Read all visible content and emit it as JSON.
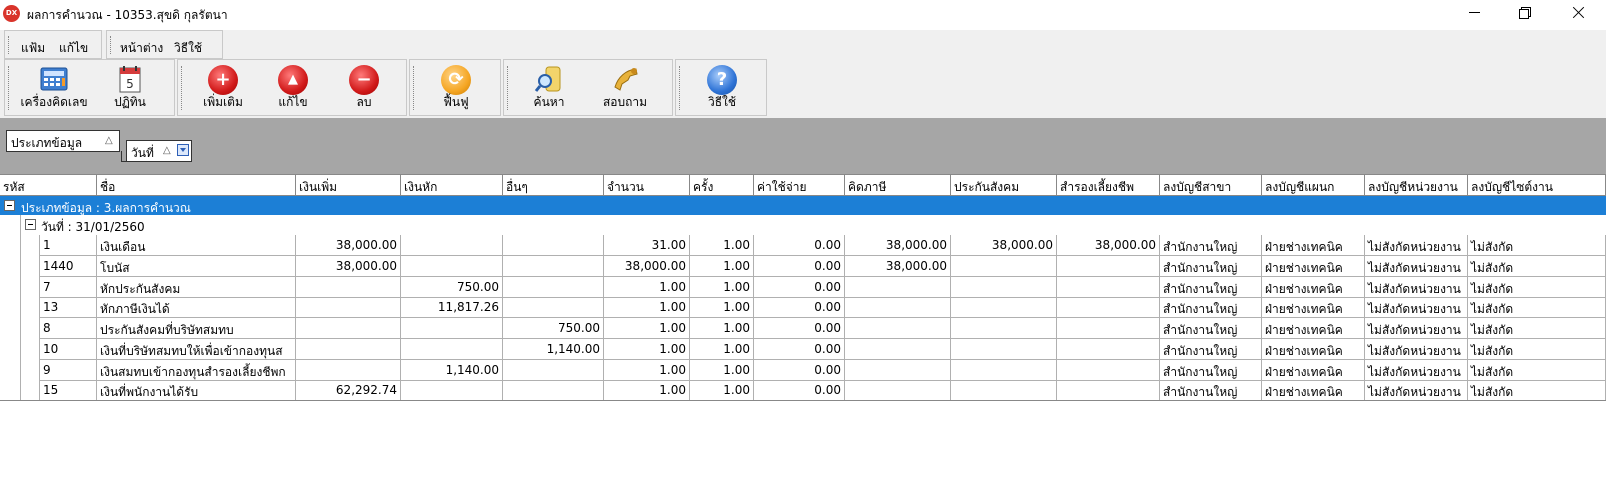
{
  "window": {
    "app_icon": "DX",
    "title": "ผลการคำนวณ - 10353.สุขดิ กุลรัตนา"
  },
  "menu": {
    "group1": [
      "แฟ้ม",
      "แก้ไข"
    ],
    "group2": [
      "หน้าต่าง",
      "วิธีใช้"
    ]
  },
  "toolbar": {
    "calculator": "เครื่องคิดเลข",
    "calendar": "ปฏิทิน",
    "calendar_day": "5",
    "add": "เพิ่มเติม",
    "edit": "แก้ไข",
    "delete": "ลบ",
    "restore": "ฟื้นฟู",
    "search": "ค้นหา",
    "inquiry": "สอบถาม",
    "help": "วิธีใช้"
  },
  "group_panel": {
    "field1": "ประเภทข้อมูล",
    "field2": "วันที่"
  },
  "columns": [
    "รหัส",
    "ชื่อ",
    "เงินเพิ่ม",
    "เงินหัก",
    "อื่นๆ",
    "จำนวน",
    "ครั้ง",
    "ค่าใช้จ่าย",
    "คิดภาษี",
    "ประกันสังคม",
    "สำรองเลี้ยงชีพ",
    "ลงบัญชีสาขา",
    "ลงบัญชีแผนก",
    "ลงบัญชีหน่วยงาน",
    "ลงบัญชีไซต์งาน"
  ],
  "group_rows": {
    "level1": "ประเภทข้อมูล : 3.ผลการคำนวณ",
    "level2": "วันที่ : 31/01/2560"
  },
  "rows": [
    [
      "1",
      "เงินเดือน",
      "38,000.00",
      "",
      "",
      "31.00",
      "1.00",
      "0.00",
      "38,000.00",
      "38,000.00",
      "38,000.00",
      "สำนักงานใหญ่",
      "ฝ่ายช่างเทคนิค",
      "ไม่สังกัดหน่วยงาน",
      "ไม่สังกัด"
    ],
    [
      "1440",
      "โบนัส",
      "38,000.00",
      "",
      "",
      "38,000.00",
      "1.00",
      "0.00",
      "38,000.00",
      "",
      "",
      "สำนักงานใหญ่",
      "ฝ่ายช่างเทคนิค",
      "ไม่สังกัดหน่วยงาน",
      "ไม่สังกัด"
    ],
    [
      "7",
      "หักประกันสังคม",
      "",
      "750.00",
      "",
      "1.00",
      "1.00",
      "0.00",
      "",
      "",
      "",
      "สำนักงานใหญ่",
      "ฝ่ายช่างเทคนิค",
      "ไม่สังกัดหน่วยงาน",
      "ไม่สังกัด"
    ],
    [
      "13",
      "หักภาษีเงินได้",
      "",
      "11,817.26",
      "",
      "1.00",
      "1.00",
      "0.00",
      "",
      "",
      "",
      "สำนักงานใหญ่",
      "ฝ่ายช่างเทคนิค",
      "ไม่สังกัดหน่วยงาน",
      "ไม่สังกัด"
    ],
    [
      "8",
      "ประกันสังคมที่บริษัทสมทบ",
      "",
      "",
      "750.00",
      "1.00",
      "1.00",
      "0.00",
      "",
      "",
      "",
      "สำนักงานใหญ่",
      "ฝ่ายช่างเทคนิค",
      "ไม่สังกัดหน่วยงาน",
      "ไม่สังกัด"
    ],
    [
      "10",
      "เงินที่บริษัทสมทบให้เพื่อเข้ากองทุนส",
      "",
      "",
      "1,140.00",
      "1.00",
      "1.00",
      "0.00",
      "",
      "",
      "",
      "สำนักงานใหญ่",
      "ฝ่ายช่างเทคนิค",
      "ไม่สังกัดหน่วยงาน",
      "ไม่สังกัด"
    ],
    [
      "9",
      "เงินสมทบเข้ากองทุนสำรองเลี้ยงชีพก",
      "",
      "1,140.00",
      "",
      "1.00",
      "1.00",
      "0.00",
      "",
      "",
      "",
      "สำนักงานใหญ่",
      "ฝ่ายช่างเทคนิค",
      "ไม่สังกัดหน่วยงาน",
      "ไม่สังกัด"
    ],
    [
      "15",
      "เงินที่พนักงานได้รับ",
      "62,292.74",
      "",
      "",
      "1.00",
      "1.00",
      "0.00",
      "",
      "",
      "",
      "สำนักงานใหญ่",
      "ฝ่ายช่างเทคนิค",
      "ไม่สังกัดหน่วยงาน",
      "ไม่สังกัด"
    ]
  ]
}
